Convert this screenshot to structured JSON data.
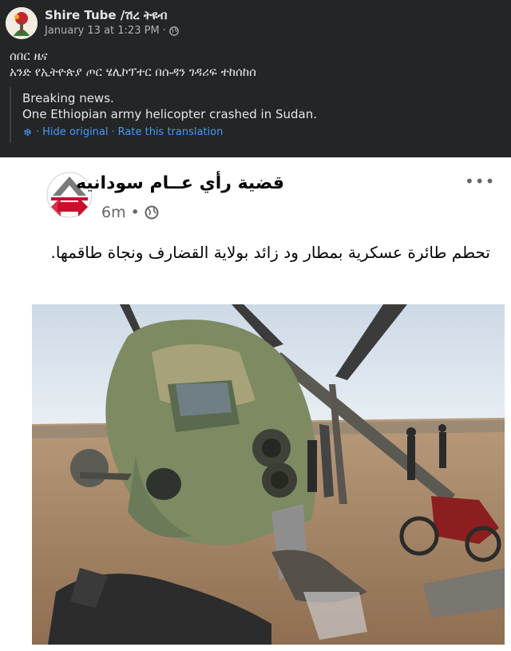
{
  "original_post": {
    "page_name": "Shire Tube /ሽረ ትዩብ",
    "timestamp": "January 13 at 1:23 PM",
    "separator": "·",
    "body_line1": "ሰበር ዜና",
    "body_line2": "አንድ የኢትዮጵያ ጦር ሄሊኮፕተር በሱዳን ገዳሪፍ ተከሰከሰ",
    "translation": {
      "line1": "Breaking news.",
      "line2": "One Ethiopian army helicopter crashed in Sudan.",
      "hide_label": "Hide original",
      "dot": "·",
      "rate_label": "Rate this translation"
    }
  },
  "shared_post": {
    "page_name": "قضية رأي عــام سودانيه",
    "time": "6m",
    "separator": "•",
    "more_label": "•••",
    "text": "تحطم طائرة عسكرية بمطار ود زائد بولاية القضارف ونجاة طاقمها."
  },
  "colors": {
    "dark_bg": "#242526",
    "link_blue": "#4599ff",
    "logo_red": "#c8102e"
  },
  "icons": [
    "globe-icon",
    "gear-icon",
    "more-icon",
    "page-logo"
  ]
}
